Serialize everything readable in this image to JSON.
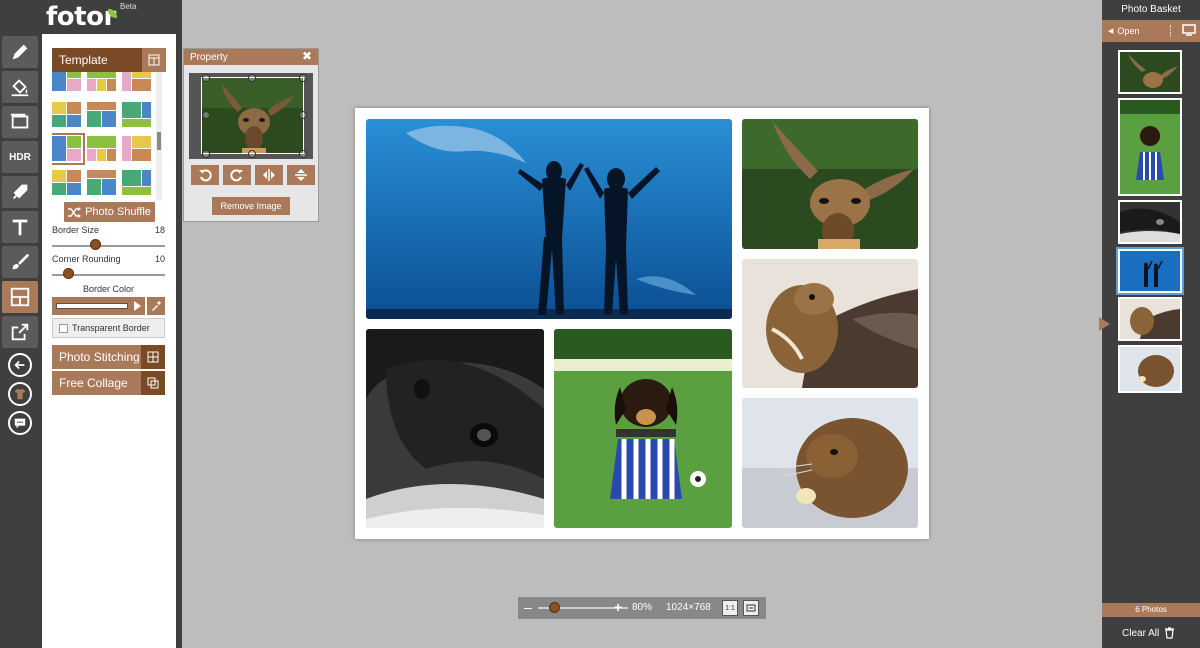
{
  "app": {
    "logo": "fotor",
    "beta": "Beta"
  },
  "tools": [
    {
      "name": "edit-tool",
      "icon": "pencil-icon"
    },
    {
      "name": "effect-tool",
      "icon": "paint-bucket-icon"
    },
    {
      "name": "frame-tool",
      "icon": "frame-icon"
    },
    {
      "name": "hdr-tool",
      "label": "HDR"
    },
    {
      "name": "tilt-shift-tool",
      "icon": "rocket-icon"
    },
    {
      "name": "text-tool",
      "icon": "text-icon"
    },
    {
      "name": "brush-tool",
      "icon": "brush-icon"
    },
    {
      "name": "collage-tool",
      "icon": "collage-icon",
      "active": true
    },
    {
      "name": "export-tool",
      "icon": "export-icon"
    }
  ],
  "left_panel": {
    "template_label": "Template",
    "shuffle_label": "Photo Shuffle",
    "border_size": {
      "label": "Border Size",
      "value": "18",
      "fraction": 0.38
    },
    "corner_rounding": {
      "label": "Corner Rounding",
      "value": "10",
      "fraction": 0.14
    },
    "border_color_label": "Border Color",
    "border_color": "#ffffff",
    "transparent_label": "Transparent Border",
    "stitching_label": "Photo Stitching",
    "free_collage_label": "Free Collage"
  },
  "property": {
    "title": "Property",
    "remove_label": "Remove Image"
  },
  "zoom": {
    "value": "80%",
    "dimensions": "1024×768",
    "fraction": 0.12
  },
  "basket": {
    "title": "Photo Basket",
    "open_label": "Open",
    "count_label": "6 Photos",
    "clear_label": "Clear All"
  },
  "colors": {
    "accent": "#a9795a",
    "accent_dark": "#7a4a26",
    "chrome": "#3f3f3f",
    "workspace": "#bdbdbd"
  }
}
